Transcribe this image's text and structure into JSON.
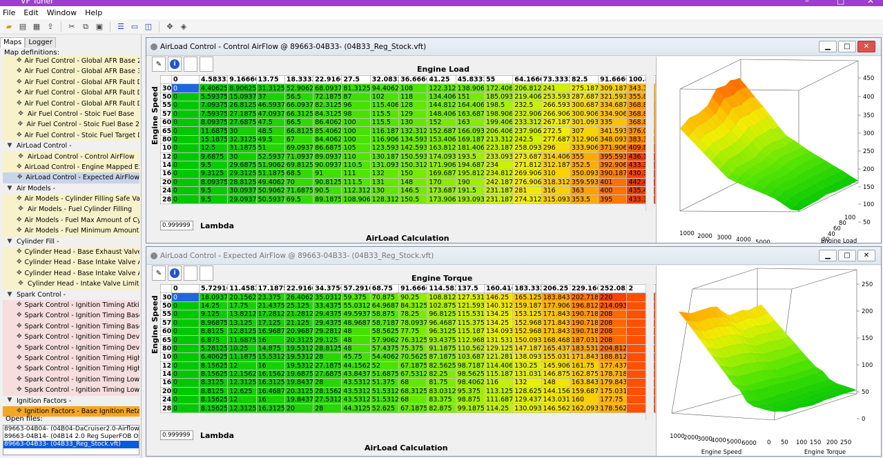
{
  "app": {
    "title": "VF Tuner"
  },
  "menu": [
    "File",
    "Edit",
    "Window",
    "Help"
  ],
  "left": {
    "tabs": [
      "Maps",
      "Logger"
    ],
    "mapdef_label": "Map definitions:",
    "open_files_label": "Open files:",
    "tree": [
      {
        "label": "Air Fuel Control - Global AFR Base 2",
        "type": "map",
        "color": "#f7f2c9"
      },
      {
        "label": "Air Fuel Control - Global AFR Base 3",
        "type": "map",
        "color": "#f7f2c9"
      },
      {
        "label": "Air Fuel Control - Global AFR Fault D",
        "type": "map",
        "color": "#f7f2c9"
      },
      {
        "label": "Air Fuel Control - Global AFR Fault D",
        "type": "map",
        "color": "#f7f2c9"
      },
      {
        "label": "Air Fuel Control - Global AFR Fault D",
        "type": "map",
        "color": "#f7f2c9"
      },
      {
        "label": "Air Fuel Control - Stoic Fuel Base",
        "type": "map",
        "color": "#f7f2c9"
      },
      {
        "label": "Air Fuel Control - Stoic Fuel Base 2",
        "type": "map",
        "color": "#f7f2c9"
      },
      {
        "label": "Air Fuel Control - Stoic Fuel Target D",
        "type": "map",
        "color": "#f7f2c9"
      },
      {
        "label": "AirLoad Control -",
        "type": "group",
        "color": "#f0f0f0"
      },
      {
        "label": "AirLoad Control - Control AirFlow",
        "type": "map",
        "color": "#f7f2c9"
      },
      {
        "label": "AirLoad Control - Engine Mapped Ex",
        "type": "map",
        "color": "#f7f2c9"
      },
      {
        "label": "AirLoad Control - Expected AirFlow",
        "type": "map",
        "color": "#c9d4e8"
      },
      {
        "label": "Air Models -",
        "type": "group",
        "color": "#f0f0f0"
      },
      {
        "label": "Air Models - Cylinder Filling Safe Val",
        "type": "map",
        "color": "#f7f2c9"
      },
      {
        "label": "Air Models - Fuel Cylinder Filling",
        "type": "map",
        "color": "#f7f2c9"
      },
      {
        "label": "Air Models - Fuel Max Amount of Cy",
        "type": "map",
        "color": "#f7f2c9"
      },
      {
        "label": "Air Models - Fuel Minimum Amount c",
        "type": "map",
        "color": "#f7f2c9"
      },
      {
        "label": "Cylinder Fill -",
        "type": "group",
        "color": "#f0f0f0"
      },
      {
        "label": "Cylinder Head - Base Exhaust Valve",
        "type": "map",
        "color": "#f7f2c9"
      },
      {
        "label": "Cylinder Head - Base Intake Valve A",
        "type": "map",
        "color": "#f7f2c9"
      },
      {
        "label": "Cylinder Head - Base Intake Valve A",
        "type": "map",
        "color": "#f7f2c9"
      },
      {
        "label": "Cylinder Head - Intake Valve Limit",
        "type": "map",
        "color": "#f7f2c9"
      },
      {
        "label": "Spark Control -",
        "type": "group",
        "color": "#f0f0f0"
      },
      {
        "label": "Spark Control - Ignition Timing Atkir",
        "type": "map",
        "color": "#f6dede"
      },
      {
        "label": "Spark Control - Ignition Timing Base",
        "type": "map",
        "color": "#f6dede"
      },
      {
        "label": "Spark Control - Ignition Timing Base",
        "type": "map",
        "color": "#f6dede"
      },
      {
        "label": "Spark Control - Ignition Timing Devi",
        "type": "map",
        "color": "#f6dede"
      },
      {
        "label": "Spark Control - Ignition Timing Devi",
        "type": "map",
        "color": "#f6dede"
      },
      {
        "label": "Spark Control - Ignition Timing High",
        "type": "map",
        "color": "#f6dede"
      },
      {
        "label": "Spark Control - Ignition Timing High",
        "type": "map",
        "color": "#f6dede"
      },
      {
        "label": "Spark Control - Ignition Timing Low",
        "type": "map",
        "color": "#f6dede"
      },
      {
        "label": "Spark Control - Ignition Timing Low",
        "type": "map",
        "color": "#f6dede"
      },
      {
        "label": "Ignition Factors -",
        "type": "group",
        "color": "#f0f0f0"
      },
      {
        "label": "Ignition Factors - Base Ignition Reta",
        "type": "map",
        "color": "#f5a623"
      }
    ],
    "open_files": [
      {
        "label": "89663-04B04- (04B04-DaCruiser2.0-Airflow-Rec",
        "selected": false
      },
      {
        "label": "89663-04B14- (04B14 2.0 Reg SuperFOB OL.vf",
        "selected": false
      },
      {
        "label": "89663-04B33- (04B33_Reg_Stock.vft)",
        "selected": true
      }
    ]
  },
  "win1": {
    "title": "AirLoad Control - Control AirFlow @ 89663-04B33- (04B33_Reg_Stock.vft)",
    "x_title": "Engine Load",
    "y_title": "Engine Speed",
    "lambda_value": "0.999999",
    "lambda_label": "Lambda",
    "calc_label": "AirLoad Calculation",
    "corner": "0",
    "cols": [
      "4.58333",
      "9.16666",
      "13.75",
      "18.3333",
      "22.9166",
      "27.5",
      "32.0833",
      "36.6666",
      "41.25",
      "45.8333",
      "55",
      "64.1666",
      "73.3333",
      "82.5",
      "91.6666",
      "100.8"
    ],
    "rows": [
      "300",
      "500",
      "550",
      "570.312",
      "600",
      "650",
      "800",
      "1000",
      "1200",
      "1400",
      "1600",
      "2000",
      "2400",
      "2800"
    ],
    "cells": [
      [
        "4.40625",
        "8.90625",
        "31.3125",
        "52.9062",
        "68.0937",
        "81.3125",
        "94.4062",
        "108",
        "122.312",
        "138.906",
        "172.406",
        "206.812",
        "241",
        "275.187",
        "309.187",
        "343.3"
      ],
      [
        "5.59375",
        "15.0937",
        "37",
        "56.5",
        "72.1875",
        "87",
        "102",
        "118",
        "134.406",
        "151",
        "185.093",
        "219.406",
        "253.593",
        "287.687",
        "321.593",
        "355.8"
      ],
      [
        "7.09375",
        "26.8125",
        "46.5937",
        "66.0937",
        "82.3125",
        "96",
        "115.406",
        "128",
        "144.812",
        "164.406",
        "198.5",
        "232.5",
        "266.593",
        "300.687",
        "334.687",
        "368.8"
      ],
      [
        "7.59375",
        "27.1875",
        "47.0937",
        "66.3125",
        "84.3125",
        "98",
        "115.5",
        "129",
        "148.406",
        "163.687",
        "198.906",
        "232.906",
        "266.906",
        "300.906",
        "334.906",
        "368.8"
      ],
      [
        "8.09375",
        "27.6875",
        "47.5",
        "66.5",
        "86.4062",
        "100",
        "115.5",
        "130",
        "152",
        "163",
        "199.406",
        "233.312",
        "267.187",
        "301.093",
        "335",
        "368.8"
      ],
      [
        "11.6875",
        "30",
        "48.5",
        "66.8125",
        "85.4062",
        "100",
        "116.187",
        "132.312",
        "152.687",
        "166.093",
        "206.406",
        "237.906",
        "272.5",
        "307",
        "341.593",
        "376.0"
      ],
      [
        "15.1875",
        "32.3125",
        "49.5",
        "67",
        "84.4062",
        "100",
        "116.906",
        "134.593",
        "153.406",
        "169.187",
        "213.312",
        "242.5",
        "277.687",
        "312.906",
        "348.093",
        "383.3"
      ],
      [
        "12.5",
        "31.1875",
        "51",
        "69.0937",
        "86.6875",
        "105",
        "123.593",
        "142.593",
        "163.812",
        "181.406",
        "223.187",
        "258.093",
        "296",
        "333.906",
        "371.906",
        "409.8"
      ],
      [
        "9.6875",
        "30",
        "52.5937",
        "71.0937",
        "89.0937",
        "110",
        "130.187",
        "150.593",
        "174.093",
        "193.5",
        "233.093",
        "273.687",
        "314.406",
        "355",
        "395.593",
        "436.1"
      ],
      [
        "9.5",
        "29.6875",
        "51.9062",
        "69.8125",
        "90.0937",
        "110.5",
        "131.093",
        "150.312",
        "171.906",
        "194.687",
        "234",
        "271.812",
        "312.187",
        "352.5",
        "392.906",
        "433.3"
      ],
      [
        "9.3125",
        "29.3125",
        "51.1875",
        "68.5",
        "91",
        "111",
        "132",
        "150",
        "169.687",
        "195.812",
        "234.812",
        "269.906",
        "310",
        "350.093",
        "390.187",
        "430.3"
      ],
      [
        "8.09375",
        "28.8125",
        "49.4062",
        "70",
        "90.8125",
        "111.5",
        "131",
        "148",
        "170",
        "190",
        "242.187",
        "276.906",
        "318.312",
        "359.593",
        "401",
        "442.4"
      ],
      [
        "9.5",
        "30.0937",
        "50.9062",
        "71.6875",
        "90.5",
        "112.312",
        "130",
        "146.5",
        "173.687",
        "191.5",
        "231.187",
        "281",
        "316",
        "363",
        "400",
        "435.4"
      ],
      [
        "9.5",
        "29.0937",
        "50.5937",
        "69.5",
        "89.1875",
        "108.906",
        "128.312",
        "150.5",
        "173.906",
        "193.093",
        "231.187",
        "274.312",
        "315.093",
        "353.5",
        "395",
        "433.3"
      ]
    ],
    "chart": {
      "z_ticks": [
        "450",
        "400",
        "350",
        "300",
        "250",
        "200",
        "150",
        "100",
        "50"
      ],
      "x_ticks": [
        "1000",
        "2000",
        "3000",
        "4000",
        "5000"
      ],
      "y_ticks": [
        "100",
        "80",
        "60",
        "40",
        "20"
      ],
      "ylabel": "Engine Load"
    }
  },
  "win2": {
    "title": "AirLoad Control - Expected AirFlow @ 89663-04B33- (04B33_Reg_Stock.vft)",
    "x_title": "Engine Torque",
    "y_title": "Engine Speed",
    "lambda_value": "0.999999",
    "lambda_label": "Lambda",
    "calc_label": "AirLoad Calculation",
    "corner": "0",
    "cols": [
      "5.72916",
      "11.4583",
      "17.1875",
      "22.9166",
      "34.3750",
      "57.2916",
      "68.75",
      "91.6666",
      "114.583",
      "137.5",
      "160.416",
      "183.333",
      "206.25",
      "229.166",
      "252.083",
      "2"
    ],
    "rows": [
      "300",
      "500",
      "550",
      "570.312",
      "600",
      "650",
      "800",
      "1000",
      "1200",
      "1400",
      "1600",
      "2000",
      "2400",
      "2800"
    ],
    "cells": [
      [
        "18.0937",
        "20.1562",
        "23.375",
        "26.4062",
        "35.0312",
        "59.375",
        "70.875",
        "90.25",
        "108.812",
        "127.531",
        "146.25",
        "165.125",
        "183.843",
        "202.718",
        "220",
        ""
      ],
      [
        "14.25",
        "17.75",
        "21.4375",
        "25.125",
        "33.4375",
        "55.0312",
        "64.9687",
        "84.3125",
        "102.875",
        "121.593",
        "140.312",
        "159.187",
        "177.906",
        "196.812",
        "214.093",
        ""
      ],
      [
        "9.125",
        "13.8212",
        "17.2812",
        "21.2812",
        "29.4375",
        "49.5937",
        "58.875",
        "78.25",
        "96.8125",
        "115.531",
        "134.25",
        "153.125",
        "171.843",
        "190.718",
        "208",
        ""
      ],
      [
        "8.96875",
        "13.125",
        "17.125",
        "21.125",
        "29.4375",
        "48.9687",
        "58.7187",
        "78.0937",
        "96.4687",
        "115.375",
        "134.25",
        "152.968",
        "171.843",
        "190.718",
        "208",
        ""
      ],
      [
        "8.8125",
        "12.8125",
        "16.9687",
        "20.9687",
        "29.2812",
        "48",
        "58.5625",
        "77.75",
        "96.3125",
        "115.187",
        "134.093",
        "152.968",
        "171.843",
        "190.718",
        "208",
        ""
      ],
      [
        "6.875",
        "11.6875",
        "16",
        "20.3125",
        "29.125",
        "48",
        "57.9062",
        "76.3125",
        "93.4375",
        "112.968",
        "131.531",
        "150.093",
        "168.468",
        "187.031",
        "208",
        ""
      ],
      [
        "5.28125",
        "10.25",
        "14.875",
        "19.5312",
        "28.8125",
        "48",
        "57.4375",
        "75.375",
        "91.1875",
        "110.562",
        "129.125",
        "147.187",
        "165.437",
        "183.531",
        "204.812",
        ""
      ],
      [
        "6.40625",
        "11.1875",
        "15.5312",
        "19.5312",
        "28",
        "45.75",
        "54.4062",
        "70.5625",
        "87.1875",
        "103.687",
        "121.281",
        "138.093",
        "155.031",
        "171.843",
        "188.812",
        ""
      ],
      [
        "8.15625",
        "12",
        "16",
        "19.5312",
        "27.1875",
        "44.1562",
        "52",
        "67.1875",
        "82.5625",
        "98.7187",
        "114.406",
        "130.25",
        "145.906",
        "161.75",
        "177.437",
        ""
      ],
      [
        "8.15625",
        "12.1562",
        "16.1562",
        "19.6875",
        "27.6875",
        "43.8437",
        "51.6875",
        "67.5312",
        "82.25",
        "98.5625",
        "115.187",
        "131.031",
        "146.875",
        "162.875",
        "178.718",
        ""
      ],
      [
        "8.3125",
        "12.3125",
        "16.3125",
        "19.8437",
        "28",
        "43.5312",
        "51.375",
        "68",
        "81.75",
        "98.4062",
        "116",
        "132",
        "148",
        "163.843",
        "179.843",
        ""
      ],
      [
        "8.8125",
        "12.625",
        "16.4687",
        "20.3125",
        "28.1562",
        "43.5312",
        "51.5312",
        "68.3125",
        "83.0312",
        "95.375",
        "113.125",
        "128.625",
        "144.156",
        "159.687",
        "175.031",
        ""
      ],
      [
        "8.15625",
        "12",
        "16",
        "19.8437",
        "27.5312",
        "43.5312",
        "51.5312",
        "68",
        "83.375",
        "98.875",
        "111.687",
        "129.437",
        "143.031",
        "160",
        "177.75",
        ""
      ],
      [
        "8.15625",
        "12.3125",
        "16.3125",
        "20",
        "28",
        "44.3125",
        "52.625",
        "67.1875",
        "82.875",
        "99.1875",
        "114.25",
        "130.093",
        "146.562",
        "162.093",
        "178.562",
        ""
      ]
    ],
    "chart": {
      "z_ticks": [
        "250",
        "200",
        "150",
        "100",
        "50",
        "0"
      ],
      "x_ticks": [
        "1000",
        "2000",
        "3000",
        "4000",
        "5000",
        "6000"
      ],
      "y_ticks": [
        "0",
        "50",
        "100",
        "150",
        "200",
        "250"
      ],
      "xlabel": "Engine Speed",
      "ylabel": "Engine Torque"
    }
  }
}
